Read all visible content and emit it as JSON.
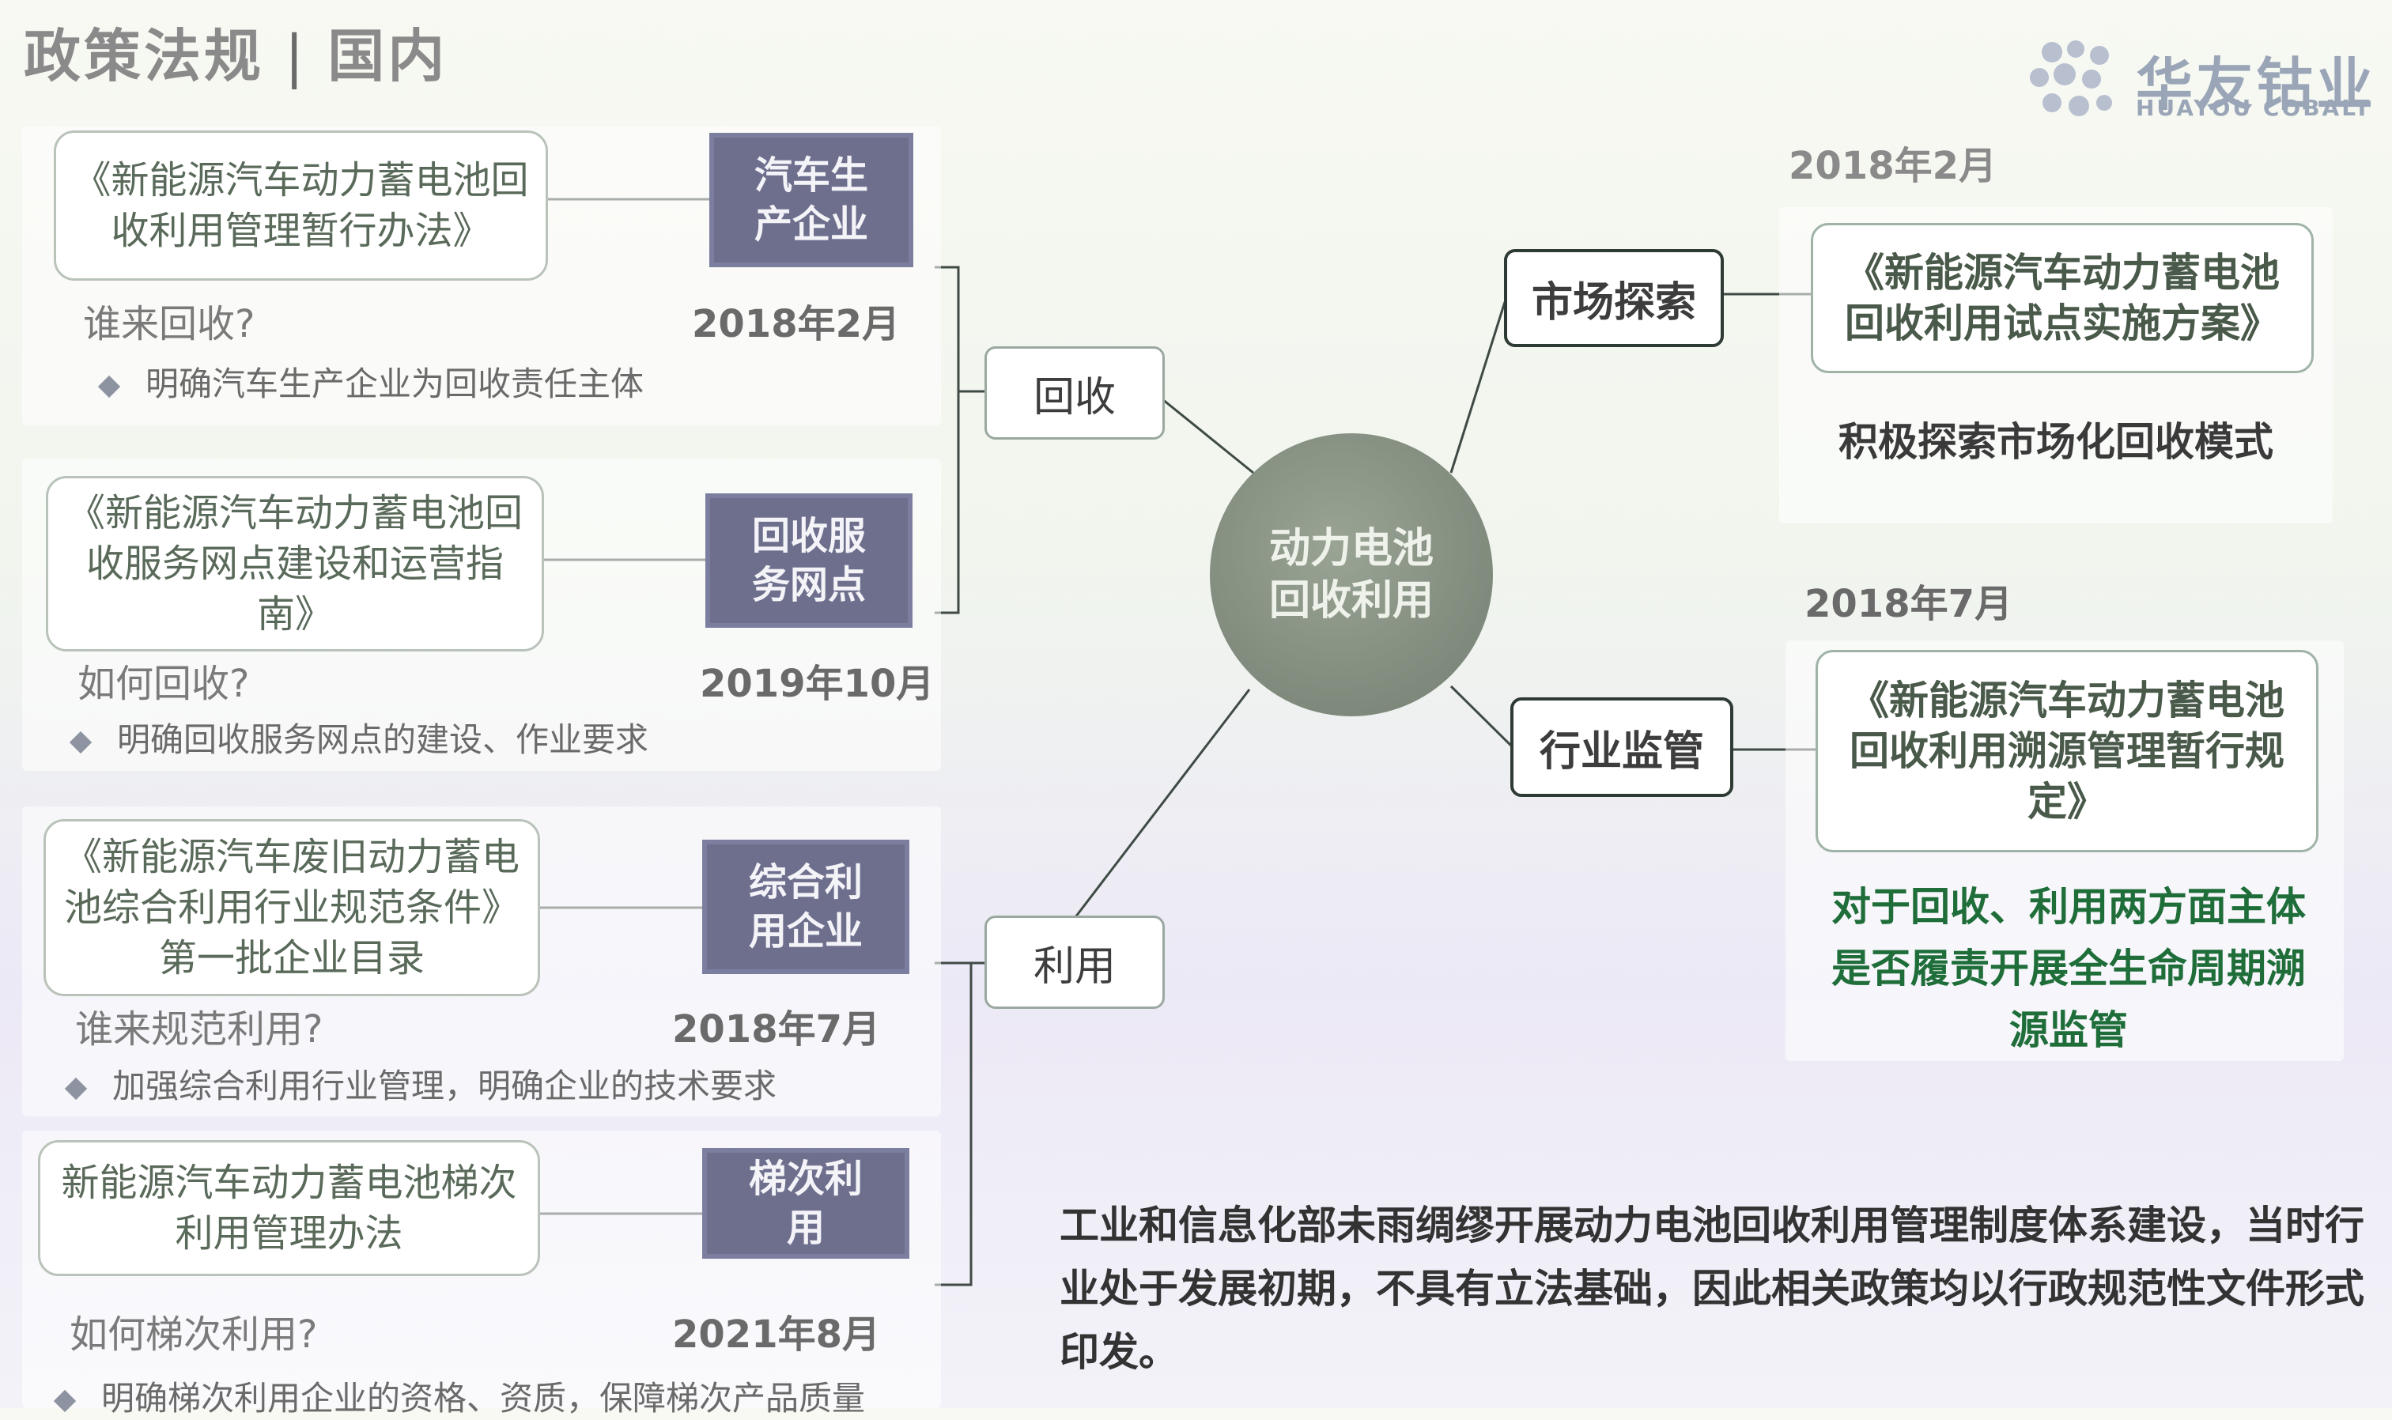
{
  "header": {
    "title_main": "政策法规",
    "title_sub": "国内"
  },
  "logo": {
    "name_cn": "华友钴业",
    "name_en": "HUAYOU COBALT",
    "icon": "cluster-dots-logo"
  },
  "center": {
    "line1": "动力电池",
    "line2": "回收利用"
  },
  "branches": {
    "recycle": "回收",
    "utilize": "利用",
    "market": "市场探索",
    "supervision": "行业监管"
  },
  "left_items": [
    {
      "doc": "《新能源汽车动力蓄电池回收利用管理暂行办法》",
      "tag": "汽车生产企业",
      "question": "谁来回收?",
      "date": "2018年2月",
      "bullet": "明确汽车生产企业为回收责任主体"
    },
    {
      "doc": "《新能源汽车动力蓄电池回收服务网点建设和运营指南》",
      "tag": "回收服务网点",
      "question": "如何回收?",
      "date": "2019年10月",
      "bullet": "明确回收服务网点的建设、作业要求"
    },
    {
      "doc": "《新能源汽车废旧动力蓄电池综合利用行业规范条件》第一批企业目录",
      "tag": "综合利用企业",
      "question": "谁来规范利用?",
      "date": "2018年7月",
      "bullet": "加强综合利用行业管理，明确企业的技术要求"
    },
    {
      "doc": "新能源汽车动力蓄电池梯次利用管理办法",
      "tag": "梯次利用",
      "question": "如何梯次利用?",
      "date": "2021年8月",
      "bullet": "明确梯次利用企业的资格、资质，保障梯次产品质量"
    }
  ],
  "right_items": [
    {
      "date": "2018年2月",
      "doc": "《新能源汽车动力蓄电池回收利用试点实施方案》",
      "note": "积极探索市场化回收模式"
    },
    {
      "date": "2018年7月",
      "doc": "《新能源汽车动力蓄电池回收利用溯源管理暂行规定》",
      "note": "对于回收、利用两方面主体是否履责开展全生命周期溯源监管"
    }
  ],
  "summary": "工业和信息化部未雨绸缪开展动力电池回收利用管理制度体系建设，当时行业处于发展初期，不具有立法基础，因此相关政策均以行政规范性文件形式印发。",
  "colors": {
    "tag_bg": "#6d6f8d",
    "center_bg": "#7f8a7c",
    "note_green": "#1f6e3a",
    "note_blue": "#2a3f8a"
  }
}
